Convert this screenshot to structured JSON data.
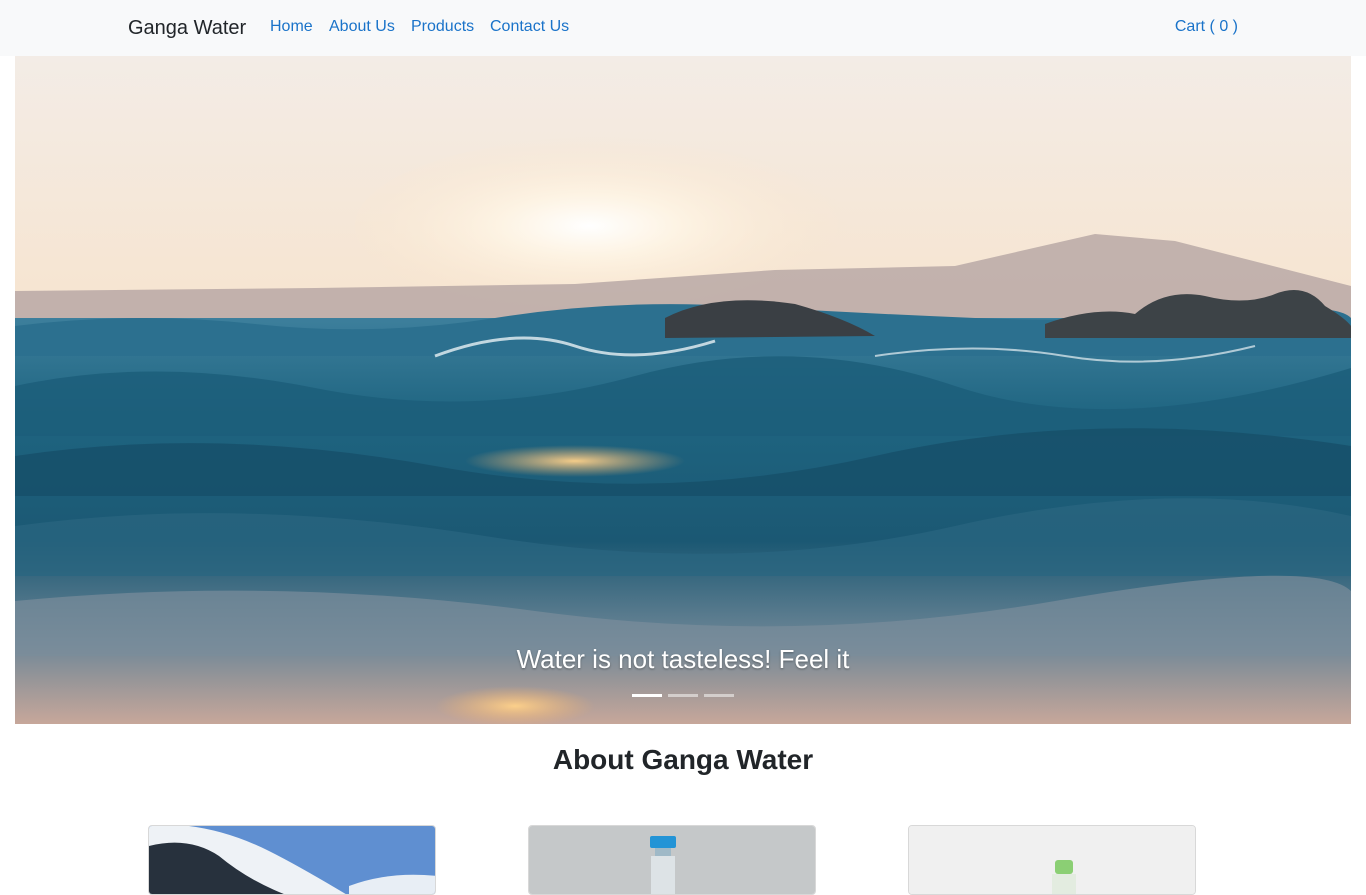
{
  "navbar": {
    "brand": "Ganga Water",
    "links": [
      "Home",
      "About Us",
      "Products",
      "Contact Us"
    ],
    "cart": "Cart ( 0 )"
  },
  "hero": {
    "caption": "Water is not tasteless! Feel it",
    "slides": 3,
    "active_slide": 1
  },
  "about": {
    "title": "About Ganga Water"
  },
  "colors": {
    "link": "#1a73c9",
    "navbar_bg": "#f8f9fa",
    "text": "#212529"
  }
}
